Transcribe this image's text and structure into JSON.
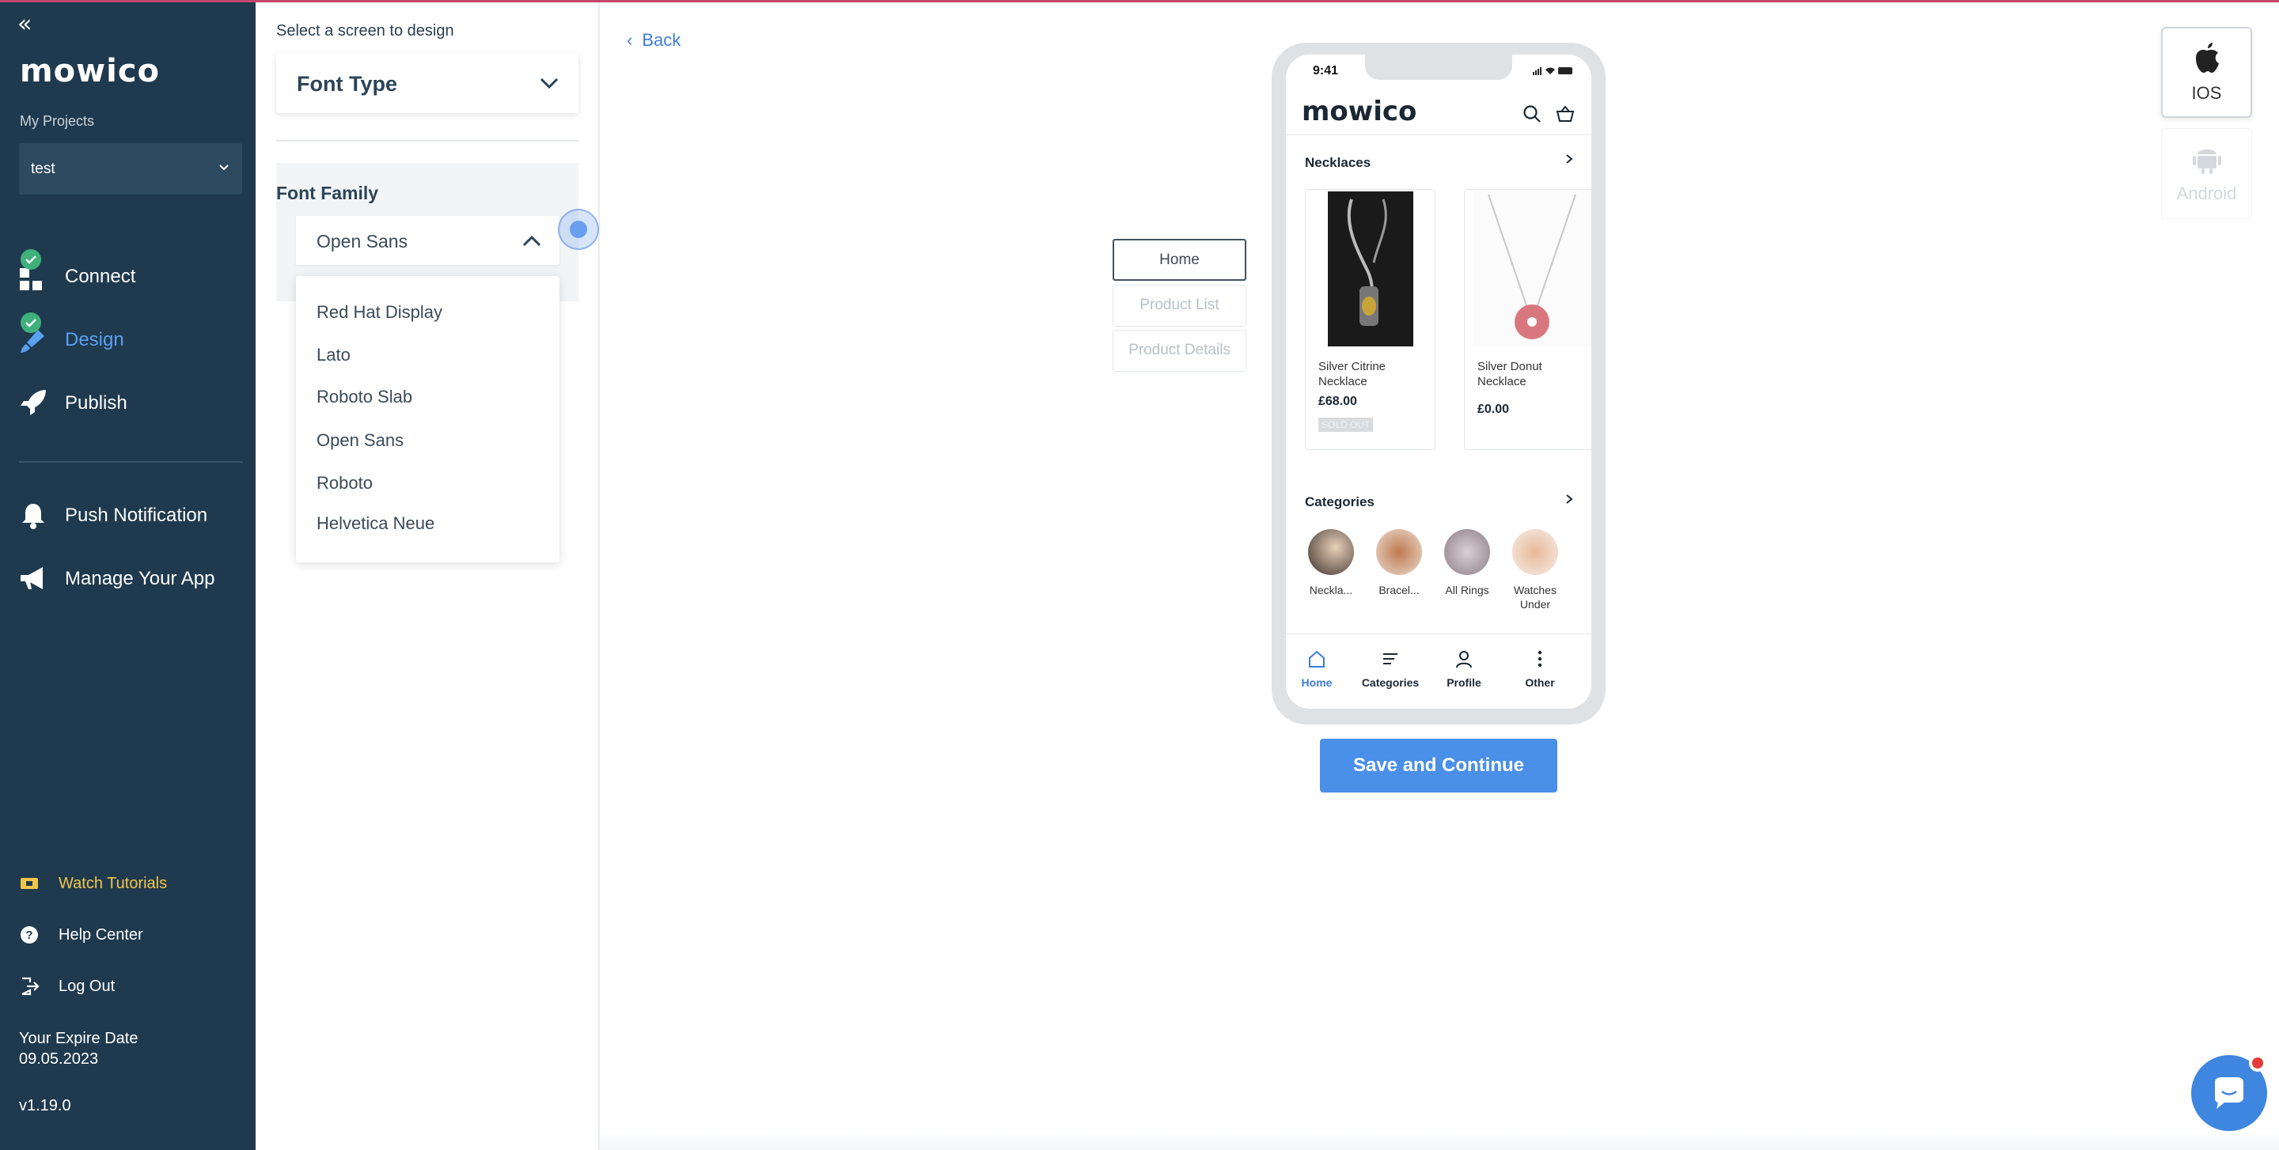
{
  "sidebar": {
    "collapse_glyph": "«",
    "logo": "mowico",
    "my_projects_label": "My Projects",
    "project_value": "test",
    "nav": [
      {
        "label": "Connect",
        "icon": "grid-icon",
        "done": true
      },
      {
        "label": "Design",
        "icon": "paintbrush-icon",
        "done": true,
        "active": true
      },
      {
        "label": "Publish",
        "icon": "rocket-icon",
        "done": false
      }
    ],
    "nav2": [
      {
        "label": "Push Notification",
        "icon": "bell-icon"
      },
      {
        "label": "Manage Your App",
        "icon": "megaphone-icon"
      }
    ],
    "bottom": [
      {
        "label": "Watch Tutorials",
        "icon": "ticket-icon"
      },
      {
        "label": "Help Center",
        "icon": "help-circle-icon"
      },
      {
        "label": "Log Out",
        "icon": "logout-icon"
      }
    ],
    "expire_label": "Your Expire Date",
    "expire_date": "09.05.2023",
    "version": "v1.19.0"
  },
  "panel": {
    "title": "Select a screen to design",
    "font_type_value": "Font Type",
    "font_family_label": "Font Family",
    "font_family_value": "Open Sans",
    "font_options": [
      "Red Hat Display",
      "Lato",
      "Roboto Slab",
      "Open Sans",
      "Roboto",
      "Helvetica Neue"
    ]
  },
  "canvas": {
    "back_label": "Back",
    "screens": [
      "Home",
      "Product List",
      "Product Details"
    ],
    "active_screen": "Home",
    "save_label": "Save and Continue"
  },
  "phone": {
    "time": "9:41",
    "logo": "mowico",
    "necklaces_title": "Necklaces",
    "products": [
      {
        "name": "Silver Citrine Necklace",
        "price": "£68.00",
        "badge": "SOLD OUT"
      },
      {
        "name": "Silver Donut Necklace",
        "price": "£0.00",
        "badge": ""
      }
    ],
    "categories_title": "Categories",
    "categories": [
      "Neckla...",
      "Bracel...",
      "All Rings",
      "Watches Under"
    ],
    "tabs": [
      "Home",
      "Categories",
      "Profile",
      "Other"
    ]
  },
  "platforms": {
    "ios": "IOS",
    "android": "Android"
  },
  "colors": {
    "sidebar_bg": "#1f3a4e",
    "accent": "#4a8fe8",
    "check_green": "#3fb07a",
    "tutorial_yellow": "#f2c54a"
  }
}
